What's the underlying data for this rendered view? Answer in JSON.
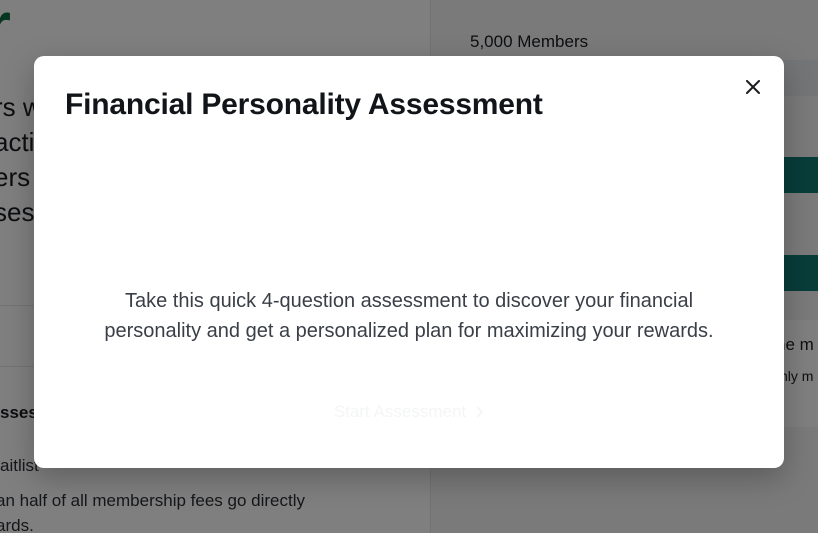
{
  "background": {
    "logo_text": "r",
    "hero_lines": [
      "rs w",
      "acti",
      "ers",
      "ses"
    ],
    "left_label": "sses",
    "waitlist_text": "aitlist",
    "body_lines": [
      "an half of all membership fees go directly",
      "ards."
    ],
    "members_count": "5,000 Members",
    "right_snippet_1": "he m",
    "right_snippet_2": "hly m"
  },
  "modal": {
    "title": "Financial Personality Assessment",
    "description": "Take this quick 4-question assessment to discover your financial personality and get a personalized plan for maximizing your rewards.",
    "start_label": "Start Assessment",
    "close_icon": "close-icon",
    "arrow_icon": "arrow-right-icon"
  },
  "colors": {
    "brand": "#0f6b45",
    "teal_band": "#117a72",
    "overlay": "rgba(0,0,0,0.5)"
  }
}
